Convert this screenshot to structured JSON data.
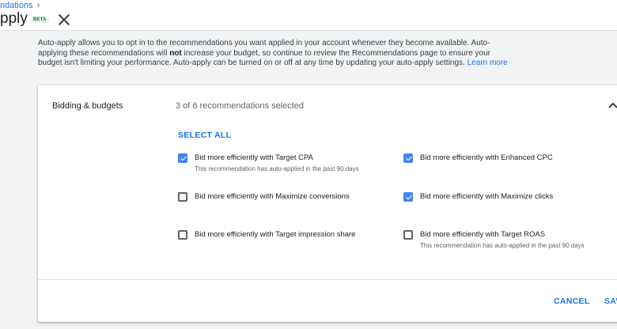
{
  "header": {
    "breadcrumb": "ndations",
    "title": "pply",
    "beta_badge": "BETA"
  },
  "intro": {
    "part1": "Auto-apply allows you to opt in to the recommendations you want applied in your account whenever they become available. Auto-applying these recommendations will ",
    "bold": "not",
    "part2": " increase your budget, so continue to review the Recommendations page to ensure your budget isn't limiting your performance. Auto-apply can be turned on or off at any time by updating your auto-apply settings. ",
    "link": "Learn more"
  },
  "card": {
    "section_title": "Bidding & budgets",
    "selected_count": "3 of 6 recommendations selected",
    "select_all": "SELECT ALL",
    "recommendations": [
      {
        "label": "Bid more efficiently with Target CPA",
        "checked": true,
        "note": "This recommendation has auto-applied in the past 90 days"
      },
      {
        "label": "Bid more efficiently with Enhanced CPC",
        "checked": true,
        "note": ""
      },
      {
        "label": "Bid more efficiently with Maximize conversions",
        "checked": false,
        "note": ""
      },
      {
        "label": "Bid more efficiently with Maximize clicks",
        "checked": true,
        "note": ""
      },
      {
        "label": "Bid more efficiently with Target impression share",
        "checked": false,
        "note": ""
      },
      {
        "label": "Bid more efficiently with Target ROAS",
        "checked": false,
        "note": "This recommendation has auto-applied in the past 90 days"
      }
    ],
    "cancel": "CANCEL",
    "save": "SAV"
  },
  "colors": {
    "accent": "#1a73e8",
    "checkbox_checked": "#4285f4",
    "beta_text": "#137333",
    "beta_bg": "#e6f4ea"
  }
}
